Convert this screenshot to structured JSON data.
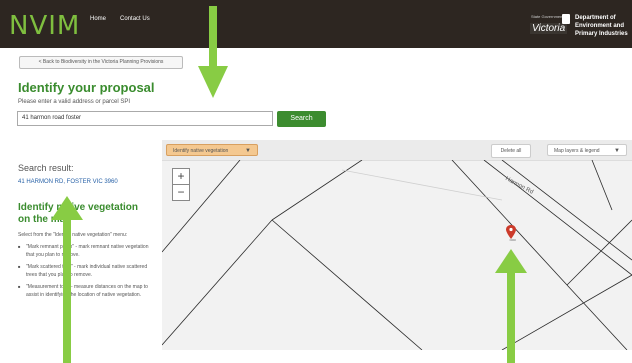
{
  "header": {
    "brand": "NVIM",
    "nav": [
      "Home",
      "Contact Us"
    ],
    "logo_small": "State Government",
    "logo_word": "Victoria",
    "department_lines": [
      "Department of",
      "Environment and",
      "Primary Industries"
    ]
  },
  "back_button": "< Back to Biodiversity in the Victoria Planning Provisions",
  "title": "Identify your proposal",
  "prompt": "Please enter a valid address or parcel SPI",
  "address_value": "41 harmon road foster",
  "search_label": "Search",
  "sidebar": {
    "result_heading": "Search result:",
    "result_value": "41 HARMON RD, FOSTER VIC 3960",
    "heading": "Identify native vegetation on the map",
    "intro": "Select from the \"Identify native vegetation\" menu:",
    "bullets": [
      "\"Mark remnant patch\" - mark remnant native vegetation that you plan to remove.",
      "\"Mark scattered tree\" - mark individual native scattered trees that you plan to remove.",
      "\"Measurement tool\" - measure distances on the map to assist in identifying the location of native vegetation."
    ]
  },
  "map": {
    "toolbar": {
      "identify": "Identify native vegetation",
      "delete": "Delete all",
      "layers": "Map layers & legend"
    },
    "zoom_in": "+",
    "zoom_out": "−",
    "road_label": "Harmon Rd",
    "pin_color": "#cc3b2b"
  },
  "icons": [
    "zoom-in-icon",
    "zoom-out-icon",
    "caret-down-icon",
    "map-pin-icon",
    "arrow-icon"
  ],
  "colors": {
    "header_bg": "#2d2621",
    "brand_green": "#7fbf3f",
    "heading_green": "#3a8c2e",
    "search_button": "#3c8c2f",
    "arrow_green": "#88cc44",
    "identify_button": "#f4c890",
    "link_blue": "#2a63a8"
  }
}
